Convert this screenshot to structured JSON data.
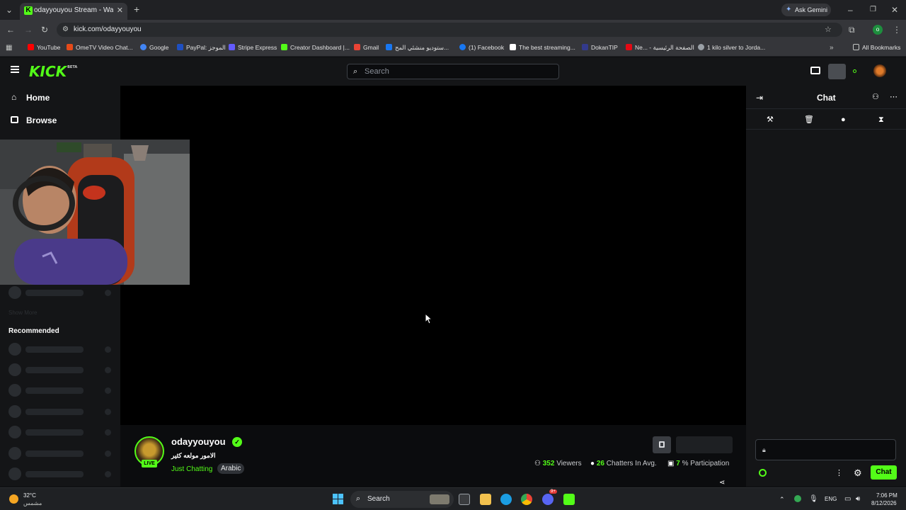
{
  "browser": {
    "tab_title": "odayyouyou Stream - Watch Li...",
    "new_tab": "+",
    "ask_gemini": "Ask Gemini",
    "url": "kick.com/odayyouyou",
    "bookmarks": [
      {
        "label": "YouTube",
        "color": "#ff0000"
      },
      {
        "label": "OmeTV Video Chat...",
        "color": "#e64a19"
      },
      {
        "label": "Google",
        "color": "#4285f4"
      },
      {
        "label": "PayPal: الموجز",
        "color": "#1e4fc2"
      },
      {
        "label": "Stripe Express",
        "color": "#635bff"
      },
      {
        "label": "Creator Dashboard |...",
        "color": "#53fc18"
      },
      {
        "label": "Gmail",
        "color": "#ea4335"
      },
      {
        "label": "ستوديو منشئي المح...",
        "color": "#1877f2"
      },
      {
        "label": "(1) Facebook",
        "color": "#1877f2"
      },
      {
        "label": "The best streaming...",
        "color": "#ffffff"
      },
      {
        "label": "DokanTIP",
        "color": "#333a8c"
      },
      {
        "label": "Ne... - الصفحة الرئيسية",
        "color": "#e50914"
      },
      {
        "label": "1 kilo silver to Jorda...",
        "color": "#9aa0a6"
      }
    ],
    "all_bookmarks": "All Bookmarks"
  },
  "header": {
    "logo": "KICK",
    "logo_badge": "BETA",
    "search_placeholder": "Search"
  },
  "sidebar": {
    "nav": [
      {
        "label": "Home",
        "icon": "home-icon"
      },
      {
        "label": "Browse",
        "icon": "browse-icon"
      }
    ],
    "show_more": "Show More",
    "recommended_title": "Recommended"
  },
  "stream": {
    "username": "odayyouyou",
    "live_badge": "LIVE",
    "title": "الامور مولعه كثير",
    "category": "Just Chatting",
    "tag": "Arabic",
    "viewers": "352",
    "viewers_label": "Viewers",
    "chatters": "26",
    "chatters_label": "Chatters In Avg.",
    "participation": "7",
    "participation_label": "% Participation"
  },
  "chat": {
    "title": "Chat",
    "send_label": "Chat"
  },
  "taskbar": {
    "weather_temp": "32°C",
    "weather_desc": "مشمس",
    "search_label": "Search",
    "lang": "ENG",
    "time": "7:06 PM",
    "date": "8/12/2026",
    "discord_badge": "9+"
  },
  "colors": {
    "accent": "#53fc18",
    "background": "#0b0c0e",
    "panel": "#141517"
  }
}
